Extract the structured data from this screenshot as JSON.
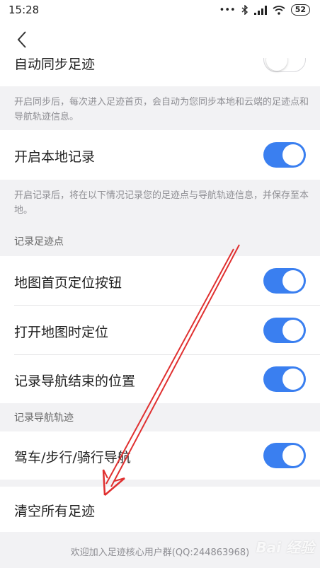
{
  "status_bar": {
    "time": "15:28",
    "icons": [
      "more-dots-icon",
      "bluetooth-icon",
      "signal-icon",
      "wifi-icon"
    ],
    "battery": "52"
  },
  "nav": {
    "back_icon": "chevron-left-icon"
  },
  "auto_sync": {
    "label": "自动同步足迹",
    "enabled": false,
    "note": "开启同步后，每次进入足迹首页，会自动为您同步本地和云端的足迹点和导航轨迹信息。"
  },
  "local_record": {
    "label": "开启本地记录",
    "enabled": true,
    "note": "开启记录后，将在以下情况记录您的足迹点与导航轨迹信息，并保存至本地。"
  },
  "footprint_section": {
    "title": "记录足迹点",
    "items": [
      {
        "label": "地图首页定位按钮",
        "enabled": true
      },
      {
        "label": "打开地图时定位",
        "enabled": true
      },
      {
        "label": "记录导航结束的位置",
        "enabled": true
      }
    ]
  },
  "track_section": {
    "title": "记录导航轨迹",
    "items": [
      {
        "label": "驾车/步行/骑行导航",
        "enabled": true
      }
    ]
  },
  "clear": {
    "label": "清空所有足迹"
  },
  "footer": {
    "text": "欢迎加入足迹核心用户群(QQ:244863968)"
  },
  "watermark": {
    "text": "Bai 经验"
  },
  "colors": {
    "accent": "#3a7ff0",
    "annotation_arrow": "#e03030"
  }
}
